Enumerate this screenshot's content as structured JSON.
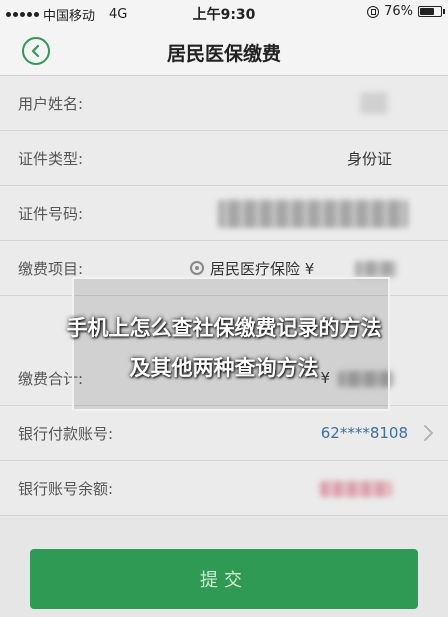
{
  "status_bar": {
    "carrier": "中国移动",
    "network": "4G",
    "time": "上午9:30",
    "battery": "76%",
    "battery_level": 0.76
  },
  "nav": {
    "title": "居民医保缴费"
  },
  "form": {
    "name_label": "用户姓名:",
    "id_type_label": "证件类型:",
    "id_type_value": "身份证",
    "id_number_label": "证件号码:",
    "item_label": "缴费项目:",
    "item_value": "居民医疗保险 ¥",
    "total_label": "缴费合计:",
    "total_currency": "¥",
    "bank_account_label": "银行付款账号:",
    "bank_account_value": "62****8108",
    "balance_label": "银行账号余额:"
  },
  "overlay": {
    "line1": "手机上怎么查社保缴费记录的方法",
    "line2": "及其他两种查询方法"
  },
  "submit": {
    "label": "提交"
  },
  "colors": {
    "accent": "#2f9a54",
    "link_blue": "#3a6f9e"
  }
}
